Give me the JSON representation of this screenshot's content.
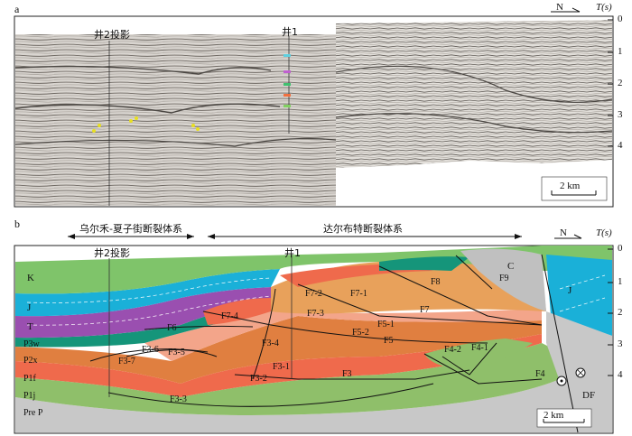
{
  "panel_a": {
    "label": "a",
    "north": "N",
    "axis_label": "T(s)",
    "ticks": [
      "0",
      "1",
      "2",
      "3",
      "4"
    ],
    "well_proj": "井2投影",
    "well_1": "井1",
    "scale": "2 km"
  },
  "panel_b": {
    "label": "b",
    "north": "N",
    "axis_label": "T(s)",
    "ticks": [
      "0",
      "1",
      "2",
      "3",
      "4"
    ],
    "system_left": "乌尔禾-夏子街断裂体系",
    "system_right": "达尔布特断裂体系",
    "well_proj": "井2投影",
    "well_1": "井1",
    "scale": "2 km",
    "strata": [
      "K",
      "J",
      "T",
      "P3w",
      "P2x",
      "P1f",
      "P1j",
      "Pre P"
    ],
    "faults": [
      "F8",
      "F9",
      "F7-2",
      "F7-1",
      "F7",
      "F7-4",
      "F7-3",
      "F6",
      "F5-2",
      "F5-1",
      "F5",
      "F3-6",
      "F3-5",
      "F3-4",
      "F3-7",
      "F3-1",
      "F3-2",
      "F4-2",
      "F4-1",
      "F3",
      "F3-3",
      "F4"
    ],
    "blocks": [
      "C",
      "J",
      "DF"
    ]
  },
  "colors": {
    "K": "#7fc46a",
    "J": "#1ab0d8",
    "T": "#9a4fb0",
    "P3w": "#15957a",
    "P2x": "#e07f40",
    "P1f": "#ef6a4c",
    "P1j": "#8fbf6a",
    "PreP": "#c8c8c8",
    "orange": "#e8a15b",
    "salmon": "#f3a58a"
  }
}
